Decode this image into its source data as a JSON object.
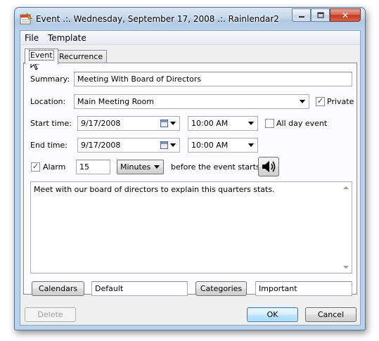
{
  "window": {
    "title": "Event .:. Wednesday, September 17, 2008 .:. Rainlendar2",
    "minimize_label": "—",
    "maximize_label": "□",
    "close_label": "✕"
  },
  "menu": {
    "file": "File",
    "template": "Template"
  },
  "tabs": {
    "event": "Event",
    "recurrence": "Recurrence"
  },
  "form": {
    "summary_label": "Summary:",
    "summary_value": "Meeting With Board of Directors",
    "location_label": "Location:",
    "location_value": "Main Meeting Room",
    "private_label": "Private",
    "private_checked": true,
    "start_label": "Start time:",
    "start_date": "9/17/2008",
    "start_time": "10:00 AM",
    "all_day_label": "All day event",
    "all_day_checked": false,
    "end_label": "End time:",
    "end_date": "9/17/2008",
    "end_time": "10:00 AM",
    "alarm_label": "Alarm",
    "alarm_checked": true,
    "alarm_value": "15",
    "alarm_unit": "Minutes",
    "alarm_suffix": "before the event starts.",
    "notes": "Meet with our board of directors to explain this quarters stats.",
    "calendars_button": "Calendars",
    "calendars_value": "Default",
    "categories_button": "Categories",
    "categories_value": "Important"
  },
  "footer": {
    "delete": "Delete",
    "ok": "OK",
    "cancel": "Cancel"
  }
}
